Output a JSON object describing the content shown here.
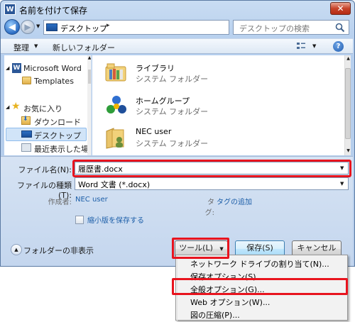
{
  "window": {
    "title": "名前を付けて保存",
    "app_icon_letter": "W"
  },
  "address": {
    "location": "デスクトップ",
    "chevron": "▸",
    "search_placeholder": "デスクトップの検索"
  },
  "toolbar": {
    "organize_label": "整理",
    "new_folder_label": "新しいフォルダー",
    "help_glyph": "?"
  },
  "sidebar": {
    "items": [
      {
        "label": "Microsoft Word",
        "icon": "word-doc-icon"
      },
      {
        "label": "Templates",
        "icon": "folder-icon"
      },
      {
        "label": "お気に入り",
        "icon": "star-icon"
      },
      {
        "label": "ダウンロード",
        "icon": "download-folder-icon"
      },
      {
        "label": "デスクトップ",
        "icon": "desktop-icon",
        "selected": true
      },
      {
        "label": "最近表示した場所",
        "icon": "recent-places-icon"
      }
    ]
  },
  "files": [
    {
      "name": "ライブラリ",
      "type": "システム フォルダー",
      "icon": "library-icon"
    },
    {
      "name": "ホームグループ",
      "type": "システム フォルダー",
      "icon": "homegroup-icon"
    },
    {
      "name": "NEC user",
      "type": "システム フォルダー",
      "icon": "user-folder-icon"
    }
  ],
  "form": {
    "filename_label": "ファイル名(N):",
    "filename_value": "履歴書.docx",
    "filetype_label": "ファイルの種類(T):",
    "filetype_value": "Word 文書 (*.docx)",
    "author_label": "作成者:",
    "author_value": "NEC user",
    "tag_label": "タグ:",
    "tag_value": "タグの追加",
    "thumbnail_label": "縮小版を保存する",
    "thumbnail_checked": false
  },
  "footer": {
    "hide_folders_label": "フォルダーの非表示",
    "tools_label": "ツール(L)",
    "save_label": "保存(S)",
    "cancel_label": "キャンセル"
  },
  "tools_menu": {
    "items": [
      "ネットワーク ドライブの割り当て(N)...",
      "保存オプション(S)...",
      "全般オプション(G)...",
      "Web オプション(W)...",
      "図の圧縮(P)..."
    ],
    "highlighted_index": 2
  },
  "colors": {
    "highlight": "#e8141e",
    "link": "#1c5ea8",
    "selection": "#d1e4f8"
  }
}
